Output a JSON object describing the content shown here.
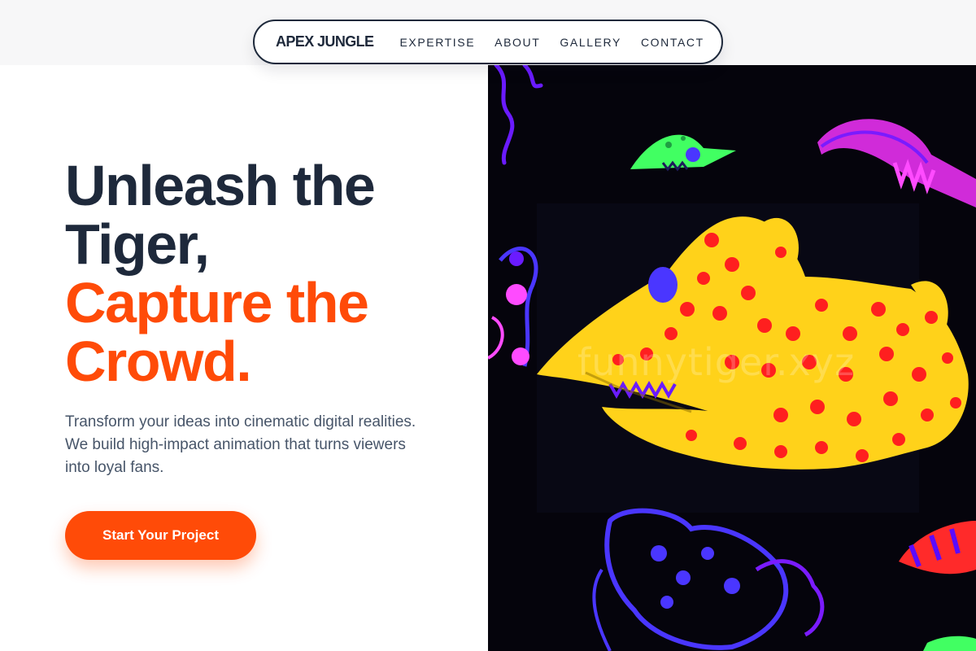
{
  "brand": "APEX JUNGLE",
  "nav": {
    "items": [
      {
        "label": "EXPERTISE"
      },
      {
        "label": "ABOUT"
      },
      {
        "label": "GALLERY"
      },
      {
        "label": "CONTACT"
      }
    ]
  },
  "hero": {
    "title_line1": "Unleash the",
    "title_line2": "Tiger,",
    "title_line3": "Capture the",
    "title_line4": "Crowd.",
    "subtitle": "Transform your ideas into cinematic digital realities. We build high-impact animation that turns viewers into loyal fans.",
    "cta_label": "Start Your Project"
  },
  "image": {
    "watermark": "funnytiger.xyz"
  },
  "colors": {
    "navy": "#1e293b",
    "accent": "#ff4b08",
    "body_text": "#475569",
    "art_background": "#05040c",
    "creature_yellow": "#ffd21a",
    "spot_red": "#ff1f1f",
    "neon_purple": "#6a1bff",
    "neon_magenta": "#e34bff",
    "neon_green": "#41ff62"
  }
}
